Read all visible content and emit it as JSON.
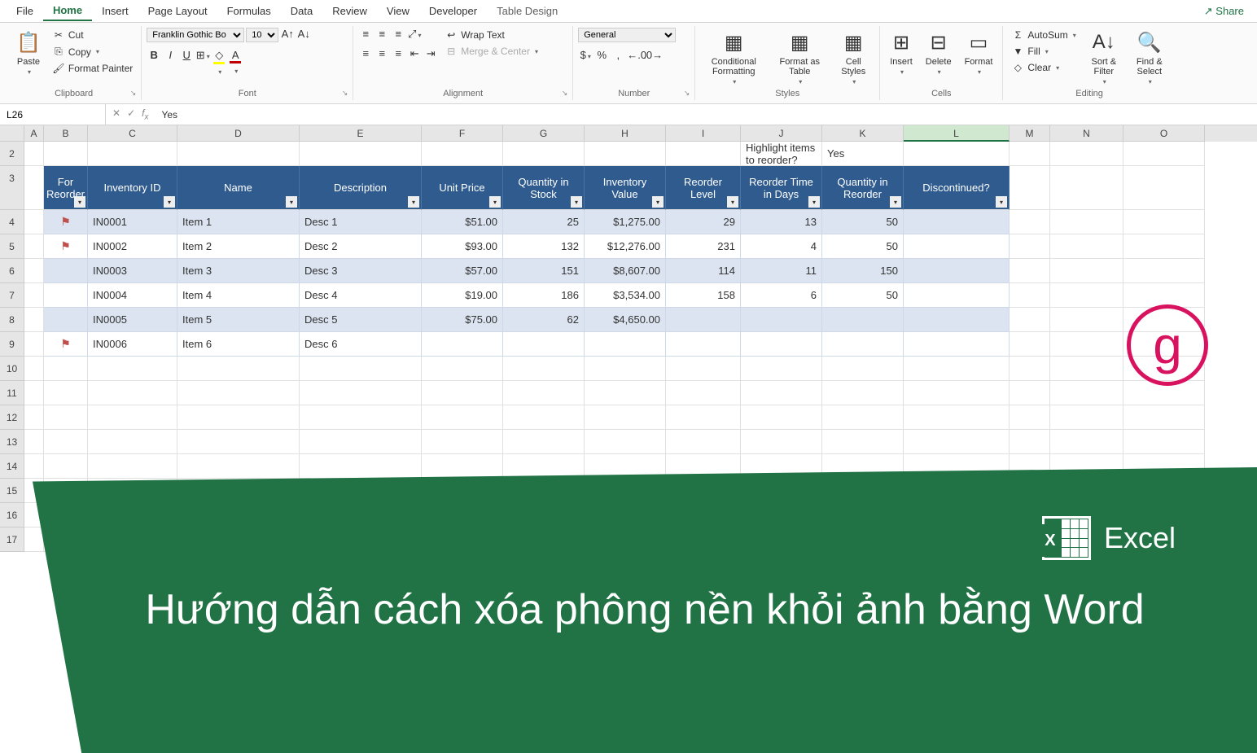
{
  "tabs": {
    "file": "File",
    "home": "Home",
    "insert": "Insert",
    "pageLayout": "Page Layout",
    "formulas": "Formulas",
    "data": "Data",
    "review": "Review",
    "view": "View",
    "developer": "Developer",
    "tableDesign": "Table Design"
  },
  "share": "Share",
  "clipboard": {
    "paste": "Paste",
    "cut": "Cut",
    "copy": "Copy",
    "formatPainter": "Format Painter",
    "label": "Clipboard"
  },
  "font": {
    "name": "Franklin Gothic Bo",
    "size": "10",
    "label": "Font"
  },
  "alignment": {
    "wrapText": "Wrap Text",
    "mergeCenter": "Merge & Center",
    "label": "Alignment"
  },
  "number": {
    "format": "General",
    "label": "Number"
  },
  "styles": {
    "conditional": "Conditional Formatting",
    "formatAs": "Format as Table",
    "cellStyles": "Cell Styles",
    "label": "Styles"
  },
  "cells": {
    "insert": "Insert",
    "delete": "Delete",
    "format": "Format",
    "label": "Cells"
  },
  "editing": {
    "autosum": "AutoSum",
    "fill": "Fill",
    "clear": "Clear",
    "sortFilter": "Sort & Filter",
    "findSelect": "Find & Select",
    "label": "Editing"
  },
  "nameBox": "L26",
  "formulaValue": "Yes",
  "columnHeaders": [
    "A",
    "B",
    "C",
    "D",
    "E",
    "F",
    "G",
    "H",
    "I",
    "J",
    "K",
    "L",
    "M",
    "N",
    "O"
  ],
  "rowHeaders": [
    "2",
    "3",
    "4",
    "5",
    "6",
    "7",
    "8",
    "9",
    "10",
    "11",
    "12",
    "13",
    "14",
    "15",
    "16",
    "17"
  ],
  "highlightText": "Highlight items to reorder?",
  "highlightValue": "Yes",
  "tableHeaders": [
    "For Reorder",
    "Inventory ID",
    "Name",
    "Description",
    "Unit Price",
    "Quantity in Stock",
    "Inventory Value",
    "Reorder Level",
    "Reorder Time in Days",
    "Quantity in Reorder",
    "Discontinued?"
  ],
  "tableRows": [
    {
      "flag": true,
      "id": "IN0001",
      "name": "Item 1",
      "desc": "Desc 1",
      "price": "$51.00",
      "stock": "25",
      "value": "$1,275.00",
      "reorderLevel": "29",
      "days": "13",
      "reorderQty": "50",
      "disc": ""
    },
    {
      "flag": true,
      "id": "IN0002",
      "name": "Item 2",
      "desc": "Desc 2",
      "price": "$93.00",
      "stock": "132",
      "value": "$12,276.00",
      "reorderLevel": "231",
      "days": "4",
      "reorderQty": "50",
      "disc": ""
    },
    {
      "flag": false,
      "id": "IN0003",
      "name": "Item 3",
      "desc": "Desc 3",
      "price": "$57.00",
      "stock": "151",
      "value": "$8,607.00",
      "reorderLevel": "114",
      "days": "11",
      "reorderQty": "150",
      "disc": ""
    },
    {
      "flag": false,
      "id": "IN0004",
      "name": "Item 4",
      "desc": "Desc 4",
      "price": "$19.00",
      "stock": "186",
      "value": "$3,534.00",
      "reorderLevel": "158",
      "days": "6",
      "reorderQty": "50",
      "disc": ""
    },
    {
      "flag": false,
      "id": "IN0005",
      "name": "Item 5",
      "desc": "Desc 5",
      "price": "$75.00",
      "stock": "62",
      "value": "$4,650.00",
      "reorderLevel": "",
      "days": "",
      "reorderQty": "",
      "disc": ""
    },
    {
      "flag": true,
      "id": "IN0006",
      "name": "Item 6",
      "desc": "Desc 6",
      "price": "",
      "stock": "",
      "value": "",
      "reorderLevel": "",
      "days": "",
      "reorderQty": "",
      "disc": ""
    }
  ],
  "overlay": {
    "excel": "Excel",
    "title": "Hướng dẫn cách xóa phông nền khỏi ảnh bằng Word"
  },
  "logoG": "g"
}
